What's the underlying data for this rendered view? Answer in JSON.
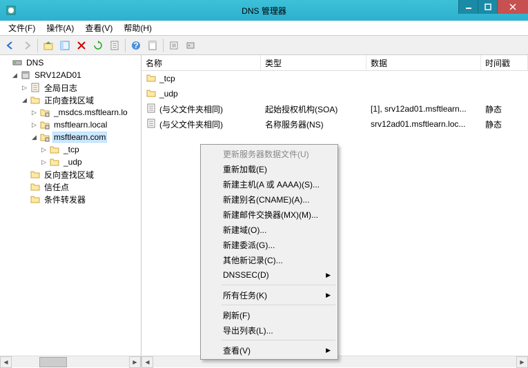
{
  "window": {
    "title": "DNS 管理器"
  },
  "menus": {
    "file": "文件(F)",
    "action": "操作(A)",
    "view": "查看(V)",
    "help": "帮助(H)"
  },
  "tree": {
    "root": "DNS",
    "server": "SRV12AD01",
    "global_log": "全局日志",
    "fwd_zone": "正向查找区域",
    "rev_zone": "反向查找区域",
    "trust": "信任点",
    "cond_fwd": "条件转发器",
    "zone_msdcs": "_msdcs.msftlearn.lo",
    "zone_msftlearn_local": "msftlearn.local",
    "zone_msftlearn_com": "msftlearn.com",
    "tcp": "_tcp",
    "udp": "_udp"
  },
  "columns": {
    "name": "名称",
    "type": "类型",
    "data": "数据",
    "time": "时间戳"
  },
  "rows": [
    {
      "name": "_tcp",
      "type": "",
      "data": "",
      "time": "",
      "icon": "folder"
    },
    {
      "name": "_udp",
      "type": "",
      "data": "",
      "time": "",
      "icon": "folder"
    },
    {
      "name": "(与父文件夹相同)",
      "type": "起始授权机构(SOA)",
      "data": "[1], srv12ad01.msftlearn...",
      "time": "静态",
      "icon": "record"
    },
    {
      "name": "(与父文件夹相同)",
      "type": "名称服务器(NS)",
      "data": "srv12ad01.msftlearn.loc...",
      "time": "静态",
      "icon": "record"
    }
  ],
  "ctx": {
    "update_data_file": "更新服务器数据文件(U)",
    "reload": "重新加载(E)",
    "new_host": "新建主机(A 或 AAAA)(S)...",
    "new_alias": "新建别名(CNAME)(A)...",
    "new_mx": "新建邮件交换器(MX)(M)...",
    "new_domain": "新建域(O)...",
    "new_delegation": "新建委派(G)...",
    "other_new": "其他新记录(C)...",
    "dnssec": "DNSSEC(D)",
    "all_tasks": "所有任务(K)",
    "refresh": "刷新(F)",
    "export_list": "导出列表(L)...",
    "view": "查看(V)"
  }
}
